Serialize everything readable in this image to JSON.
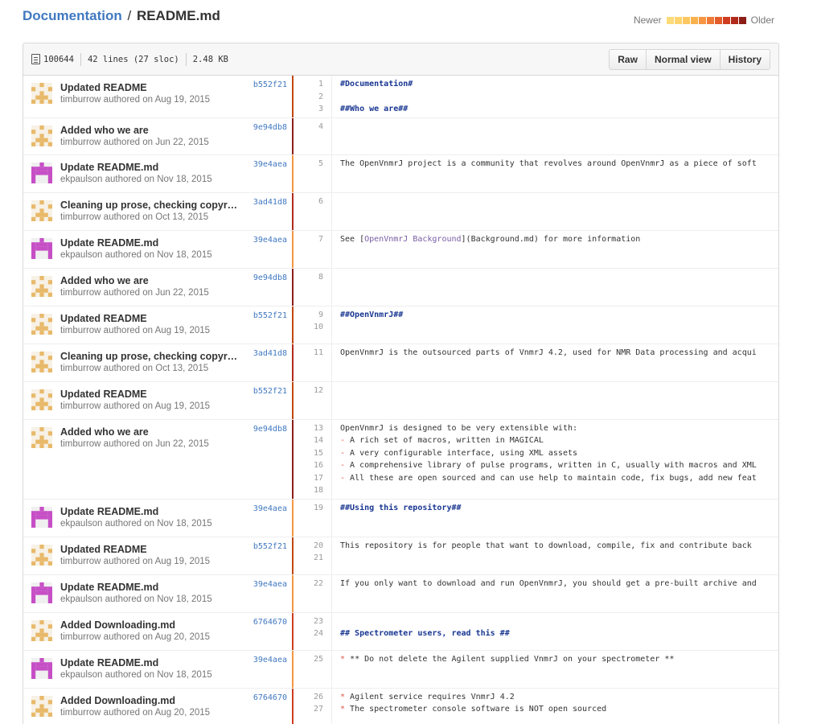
{
  "breadcrumb": {
    "root": "Documentation",
    "separator": "/",
    "file": "README.md"
  },
  "legend": {
    "newer": "Newer",
    "older": "Older",
    "colors": [
      "#fddb7a",
      "#fdd46d",
      "#fcc761",
      "#f9b14e",
      "#f69542",
      "#ee7a37",
      "#e35c2a",
      "#cf3c1f",
      "#b22a1c",
      "#8c1e18"
    ]
  },
  "file_info": {
    "mode": "100644",
    "lines": "42 lines (27 sloc)",
    "size": "2.48 KB"
  },
  "buttons": {
    "raw": "Raw",
    "normal": "Normal view",
    "history": "History"
  },
  "rows": [
    {
      "msg": "Updated README",
      "meta": "timburrow authored on Aug 19, 2015",
      "sha": "b552f21",
      "avatar": "tim",
      "heat": "#c2470e",
      "nums": [
        "1",
        "2",
        "3"
      ],
      "code": [
        [
          "h",
          "#Documentation#"
        ],
        [
          "",
          ""
        ],
        [
          "h",
          "##Who we are##"
        ]
      ]
    },
    {
      "msg": "Added who we are",
      "meta": "timburrow authored on Jun 22, 2015",
      "sha": "9e94db8",
      "avatar": "tim",
      "heat": "#8c1e18",
      "nums": [
        "4"
      ],
      "code": [
        [
          "",
          ""
        ]
      ],
      "height": 46
    },
    {
      "msg": "Update README.md",
      "meta": "ekpaulson authored on Nov 18, 2015",
      "sha": "39e4aea",
      "avatar": "ek",
      "heat": "#f69542",
      "nums": [
        "5"
      ],
      "code": [
        [
          "",
          "The OpenVnmrJ project is a community that revolves around OpenVnmrJ as a piece of soft"
        ]
      ],
      "height": 47
    },
    {
      "msg": "Cleaning up prose, checking copyr…",
      "meta": "timburrow authored on Oct 13, 2015",
      "sha": "3ad41d8",
      "avatar": "tim",
      "heat": "#b22a1c",
      "nums": [
        "6"
      ],
      "code": [
        [
          "",
          ""
        ]
      ],
      "height": 47
    },
    {
      "msg": "Update README.md",
      "meta": "ekpaulson authored on Nov 18, 2015",
      "sha": "39e4aea",
      "avatar": "ek",
      "heat": "#f69542",
      "nums": [
        "7"
      ],
      "code": [
        [
          "link",
          "See [OpenVnmrJ Background](Background.md) for more information"
        ]
      ],
      "height": 47
    },
    {
      "msg": "Added who we are",
      "meta": "timburrow authored on Jun 22, 2015",
      "sha": "9e94db8",
      "avatar": "tim",
      "heat": "#8c1e18",
      "nums": [
        "8"
      ],
      "code": [
        [
          "",
          ""
        ]
      ],
      "height": 47
    },
    {
      "msg": "Updated README",
      "meta": "timburrow authored on Aug 19, 2015",
      "sha": "b552f21",
      "avatar": "tim",
      "heat": "#c2470e",
      "nums": [
        "9",
        "10"
      ],
      "code": [
        [
          "h",
          "##OpenVnmrJ##"
        ],
        [
          "",
          ""
        ]
      ],
      "height": 47
    },
    {
      "msg": "Cleaning up prose, checking copyr…",
      "meta": "timburrow authored on Oct 13, 2015",
      "sha": "3ad41d8",
      "avatar": "tim",
      "heat": "#b22a1c",
      "nums": [
        "11"
      ],
      "code": [
        [
          "",
          "OpenVnmrJ is the outsourced parts of VnmrJ 4.2, used for NMR Data processing and acqui"
        ]
      ],
      "height": 47
    },
    {
      "msg": "Updated README",
      "meta": "timburrow authored on Aug 19, 2015",
      "sha": "b552f21",
      "avatar": "tim",
      "heat": "#c2470e",
      "nums": [
        "12"
      ],
      "code": [
        [
          "",
          ""
        ]
      ],
      "height": 47
    },
    {
      "msg": "Added who we are",
      "meta": "timburrow authored on Jun 22, 2015",
      "sha": "9e94db8",
      "avatar": "tim",
      "heat": "#8c1e18",
      "nums": [
        "13",
        "14",
        "15",
        "16",
        "17",
        "18"
      ],
      "code": [
        [
          "",
          "OpenVnmrJ is designed to be very extensible with:"
        ],
        [
          "bullet",
          "- A rich set of macros, written in MAGICAL"
        ],
        [
          "bullet",
          "- A very configurable interface, using XML assets"
        ],
        [
          "bullet",
          "- A comprehensive library of pulse programs, written in C, usually with macros and XML"
        ],
        [
          "bullet",
          "- All these are open sourced and can use help to maintain code, fix bugs, add new feat"
        ],
        [
          "",
          ""
        ]
      ]
    },
    {
      "msg": "Update README.md",
      "meta": "ekpaulson authored on Nov 18, 2015",
      "sha": "39e4aea",
      "avatar": "ek",
      "heat": "#f69542",
      "nums": [
        "19"
      ],
      "code": [
        [
          "h",
          "##Using this repository##"
        ]
      ],
      "height": 47
    },
    {
      "msg": "Updated README",
      "meta": "timburrow authored on Aug 19, 2015",
      "sha": "b552f21",
      "avatar": "tim",
      "heat": "#c2470e",
      "nums": [
        "20",
        "21"
      ],
      "code": [
        [
          "",
          "This repository is for people that want to download, compile, fix and contribute back"
        ],
        [
          "",
          ""
        ]
      ],
      "height": 47
    },
    {
      "msg": "Update README.md",
      "meta": "ekpaulson authored on Nov 18, 2015",
      "sha": "39e4aea",
      "avatar": "ek",
      "heat": "#f69542",
      "nums": [
        "22"
      ],
      "code": [
        [
          "",
          "If you only want to download and run OpenVnmrJ, you should get a pre-built archive and"
        ]
      ],
      "height": 47
    },
    {
      "msg": "Added Downloading.md",
      "meta": "timburrow authored on Aug 20, 2015",
      "sha": "6764670",
      "avatar": "tim",
      "heat": "#cf3c1f",
      "nums": [
        "23",
        "24"
      ],
      "code": [
        [
          "",
          ""
        ],
        [
          "h",
          "## Spectrometer users, read this ##"
        ]
      ],
      "height": 47
    },
    {
      "msg": "Update README.md",
      "meta": "ekpaulson authored on Nov 18, 2015",
      "sha": "39e4aea",
      "avatar": "ek",
      "heat": "#f69542",
      "nums": [
        "25"
      ],
      "code": [
        [
          "bullet",
          "* ** Do not delete the Agilent supplied VnmrJ on your spectrometer **"
        ]
      ],
      "height": 47
    },
    {
      "msg": "Added Downloading.md",
      "meta": "timburrow authored on Aug 20, 2015",
      "sha": "6764670",
      "avatar": "tim",
      "heat": "#cf3c1f",
      "nums": [
        "26",
        "27"
      ],
      "code": [
        [
          "bullet",
          "* Agilent service requires VnmrJ 4.2"
        ],
        [
          "bullet",
          "* The spectrometer console software is NOT open sourced"
        ]
      ],
      "height": 47
    }
  ]
}
